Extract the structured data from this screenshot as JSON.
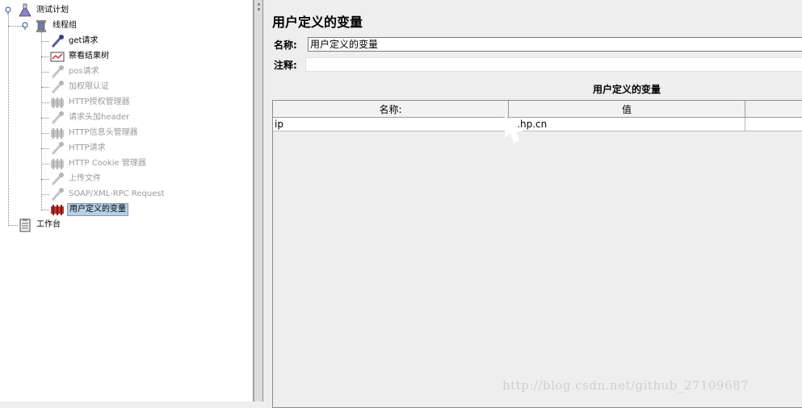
{
  "tree": {
    "items": [
      {
        "label": "测试计划",
        "icon": "test-plan-flask-icon",
        "state": "normal"
      },
      {
        "label": "线程组",
        "icon": "thread-group-spool-icon",
        "state": "normal"
      },
      {
        "label": "get请求",
        "icon": "sampler-pipette-icon",
        "state": "normal"
      },
      {
        "label": "察看结果树",
        "icon": "listener-graph-icon",
        "state": "normal"
      },
      {
        "label": "pos请求",
        "icon": "sampler-pipette-icon",
        "state": "disabled"
      },
      {
        "label": "加权限认证",
        "icon": "sampler-pipette-icon",
        "state": "disabled"
      },
      {
        "label": "HTTP授权管理器",
        "icon": "config-element-icon",
        "state": "disabled"
      },
      {
        "label": "请求头加header",
        "icon": "sampler-pipette-icon",
        "state": "disabled"
      },
      {
        "label": "HTTP信息头管理器",
        "icon": "config-element-icon",
        "state": "disabled"
      },
      {
        "label": "HTTP请求",
        "icon": "sampler-pipette-icon",
        "state": "disabled"
      },
      {
        "label": "HTTP Cookie 管理器",
        "icon": "config-element-icon",
        "state": "disabled"
      },
      {
        "label": "上传文件",
        "icon": "sampler-pipette-icon",
        "state": "disabled"
      },
      {
        "label": "SOAP/XML-RPC Request",
        "icon": "sampler-pipette-icon",
        "state": "disabled"
      },
      {
        "label": "用户定义的变量",
        "icon": "user-variables-icon",
        "state": "selected"
      },
      {
        "label": "工作台",
        "icon": "workbench-clipboard-icon",
        "state": "normal"
      }
    ]
  },
  "panel": {
    "title": "用户定义的变量",
    "name_label": "名称:",
    "name_value": "用户定义的变量",
    "comment_label": "注释:",
    "comment_value": "",
    "section_title": "用户定义的变量",
    "table": {
      "headers": [
        "名称:",
        "值",
        ""
      ],
      "rows": [
        [
          "ip",
          "…hp.cn",
          ""
        ]
      ]
    }
  },
  "watermark": "http://blog.csdn.net/github_27109687",
  "colors": {
    "selection": "#b8cfe5",
    "disabled_text": "#9a9a9a",
    "panel_bg": "#eeeeee"
  }
}
